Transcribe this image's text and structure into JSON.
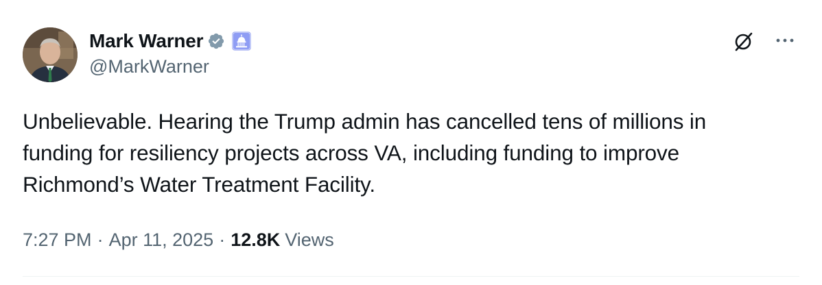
{
  "author": {
    "display_name": "Mark Warner",
    "handle": "@MarkWarner",
    "verified_icon": "gray-check-badge-icon",
    "affiliate_icon": "capitol-dome-badge-icon"
  },
  "tweet": {
    "text_lines": [
      "Unbelievable. Hearing the Trump admin has cancelled tens of millions in",
      "funding for resiliency projects across VA, including funding to improve",
      "Richmond’s Water Treatment Facility."
    ]
  },
  "meta": {
    "time": "7:27 PM",
    "separator": "·",
    "date": "Apr 11, 2025",
    "views_count": "12.8K",
    "views_label": "Views"
  },
  "actions": {
    "grok_icon": "grok-slash-icon",
    "more_icon": "more-dots-icon"
  },
  "colors": {
    "text_primary": "#0f1419",
    "text_secondary": "#536471",
    "verified_gray": "#829aab",
    "affiliate_blue": "#6b7ff0",
    "divider": "#eff3f4"
  }
}
